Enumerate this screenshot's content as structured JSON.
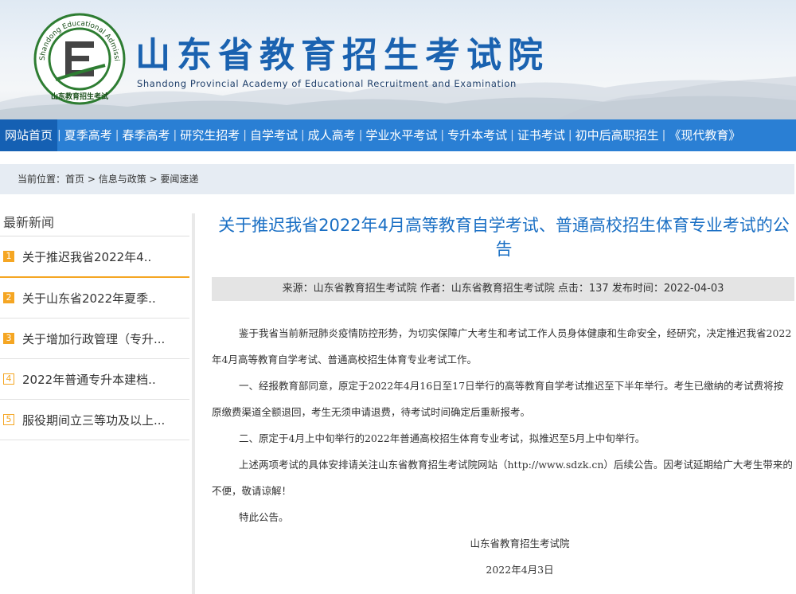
{
  "header": {
    "title": "山东省教育招生考试院",
    "subtitle": "Shandong Provincial Academy of Educational Recruitment and Examination",
    "emblem_ring_text": "Shandong Educational Admission & Examinations",
    "emblem_bottom_text": "山东教育招生考试"
  },
  "nav": {
    "items": [
      {
        "label": "网站首页"
      },
      {
        "label": "夏季高考"
      },
      {
        "label": "春季高考"
      },
      {
        "label": "研究生招考"
      },
      {
        "label": "自学考试"
      },
      {
        "label": "成人高考"
      },
      {
        "label": "学业水平考试"
      },
      {
        "label": "专升本考试"
      },
      {
        "label": "证书考试"
      },
      {
        "label": "初中后高职招生"
      },
      {
        "label": "《现代教育》"
      }
    ]
  },
  "breadcrumb": {
    "prefix": "当前位置：",
    "items": [
      "首页",
      "信息与政策",
      "要闻速递"
    ],
    "sep": " > "
  },
  "sidebar": {
    "title": "最新新闻",
    "items": [
      {
        "num": "1",
        "label": "关于推迟我省2022年4.."
      },
      {
        "num": "2",
        "label": "关于山东省2022年夏季.."
      },
      {
        "num": "3",
        "label": "关于增加行政管理（专升..."
      },
      {
        "num": "4",
        "label": "2022年普通专升本建档.."
      },
      {
        "num": "5",
        "label": "服役期间立三等功及以上..."
      }
    ]
  },
  "article": {
    "title": "关于推迟我省2022年4月高等教育自学考试、普通高校招生体育专业考试的公告",
    "meta": "来源：山东省教育招生考试院 作者：山东省教育招生考试院 点击：137 发布时间：2022-04-03",
    "paragraphs": [
      "鉴于我省当前新冠肺炎疫情防控形势，为切实保障广大考生和考试工作人员身体健康和生命安全，经研究，决定推迟我省2022年4月高等教育自学考试、普通高校招生体育专业考试工作。",
      "一、经报教育部同意，原定于2022年4月16日至17日举行的高等教育自学考试推迟至下半年举行。考生已缴纳的考试费将按原缴费渠道全额退回，考生无须申请退费，待考试时间确定后重新报考。",
      "二、原定于4月上中旬举行的2022年普通高校招生体育专业考试，拟推迟至5月上中旬举行。",
      "上述两项考试的具体安排请关注山东省教育招生考试院网站（http://www.sdzk.cn）后续公告。因考试延期给广大考生带来的不便，敬请谅解！",
      "特此公告。"
    ],
    "signature": "山东省教育招生考试院",
    "date": "2022年4月3日"
  },
  "colors": {
    "nav_bg": "#2a7fd4",
    "title_blue": "#1a62b0",
    "badge_orange": "#f5a623"
  }
}
